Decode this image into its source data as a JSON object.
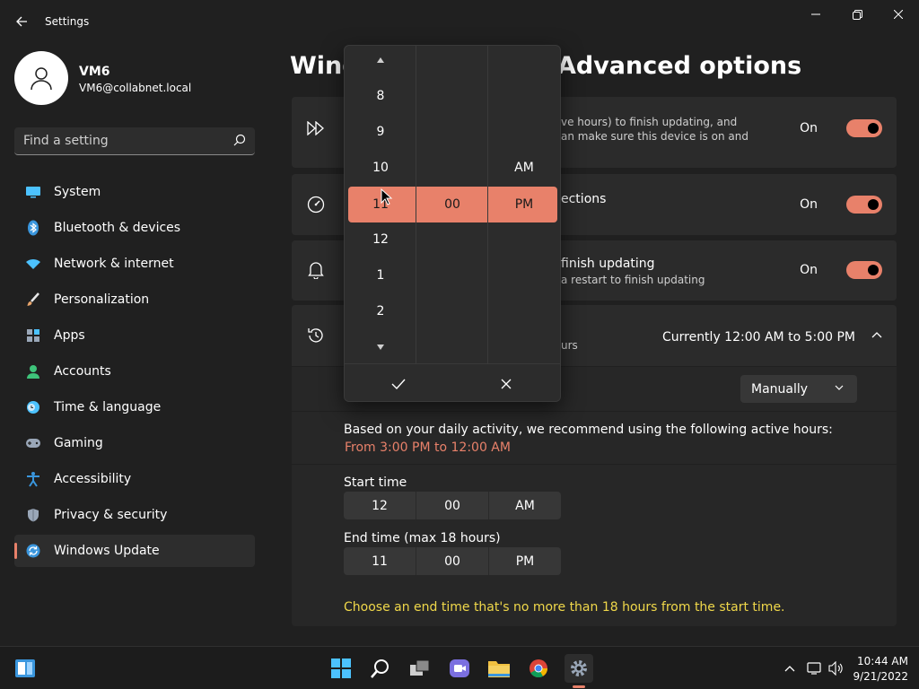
{
  "window": {
    "title": "Settings"
  },
  "user": {
    "name": "VM6",
    "email": "VM6@collabnet.local"
  },
  "search": {
    "placeholder": "Find a setting"
  },
  "sidebar": {
    "items": [
      {
        "label": "System",
        "icon": "monitor-icon",
        "color": "#4cc2ff"
      },
      {
        "label": "Bluetooth & devices",
        "icon": "bluetooth-icon",
        "color": "#3a96dd"
      },
      {
        "label": "Network & internet",
        "icon": "wifi-icon",
        "color": "#4cc2ff"
      },
      {
        "label": "Personalization",
        "icon": "brush-icon",
        "color": "#e8a46a"
      },
      {
        "label": "Apps",
        "icon": "apps-icon",
        "color": "#9aa7b8"
      },
      {
        "label": "Accounts",
        "icon": "person-icon",
        "color": "#3ec47a"
      },
      {
        "label": "Time & language",
        "icon": "globe-clock-icon",
        "color": "#4cc2ff"
      },
      {
        "label": "Gaming",
        "icon": "gamepad-icon",
        "color": "#9aa7b8"
      },
      {
        "label": "Accessibility",
        "icon": "accessibility-icon",
        "color": "#3a96dd"
      },
      {
        "label": "Privacy & security",
        "icon": "shield-icon",
        "color": "#9aa7b8"
      },
      {
        "label": "Windows Update",
        "icon": "update-icon",
        "color": "#3a96dd",
        "active": true
      }
    ]
  },
  "page": {
    "title": "Windows Update > Advanced options"
  },
  "cards": {
    "fast_updates": {
      "line1": "ve hours) to finish updating, and",
      "line2": "an make sure this device is on and",
      "state": "On",
      "icon": "fast-forward-icon"
    },
    "metered": {
      "title": "ections",
      "state": "On",
      "icon": "speedometer-icon"
    },
    "notify": {
      "title": "finish updating",
      "subtitle": "a restart to finish updating",
      "state": "On",
      "icon": "bell-icon"
    },
    "active_hours": {
      "subtitle": "urs",
      "current": "Currently 12:00 AM to 5:00 PM",
      "icon": "clock-history-icon"
    }
  },
  "active_hours": {
    "dropdown_value": "Manually",
    "recommend_text": "Based on your daily activity, we recommend using the following active hours:",
    "recommend_value": "From 3:00 PM to 12:00 AM",
    "start_label": "Start time",
    "start": {
      "hour": "12",
      "minute": "00",
      "ampm": "AM"
    },
    "end_label": "End time (max 18 hours)",
    "end": {
      "hour": "11",
      "minute": "00",
      "ampm": "PM"
    },
    "warning": "Choose an end time that's no more than 18 hours from the start time."
  },
  "picker": {
    "hours": [
      "8",
      "9",
      "10",
      "11",
      "12",
      "1",
      "2"
    ],
    "selected_hour": "11",
    "selected_minute": "00",
    "ampm_above": "AM",
    "selected_ampm": "PM"
  },
  "taskbar": {
    "time": "10:44 AM",
    "date": "9/21/2022"
  },
  "colors": {
    "accent": "#e8816a",
    "warning": "#f0d84a"
  }
}
